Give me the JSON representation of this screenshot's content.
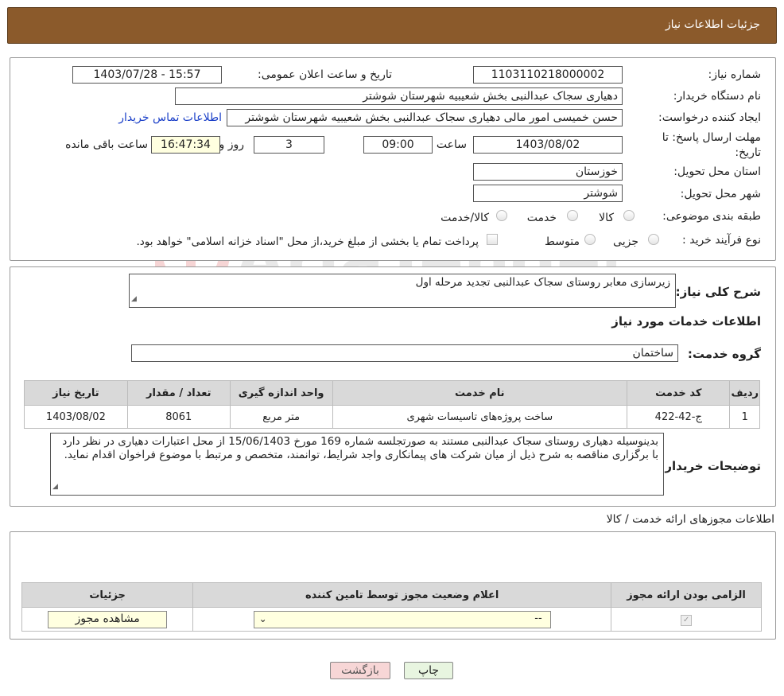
{
  "header": {
    "title": "جزئیات اطلاعات نیاز"
  },
  "form": {
    "need_number_label": "شماره نیاز:",
    "need_number": "1103110218000002",
    "announce_label": "تاریخ و ساعت اعلان عمومی:",
    "announce_value": "1403/07/28 - 15:57",
    "buyer_org_label": "نام دستگاه خریدار:",
    "buyer_org": "دهیاری سجاک عبدالنبی بخش شعیبیه شهرستان شوشتر",
    "requester_label": "ایجاد کننده درخواست:",
    "requester": "حسن خمیسی امور مالی دهیاری سجاک عبدالنبی بخش شعیبیه شهرستان شوشتر",
    "contact_link": "اطلاعات تماس خریدار",
    "deadline_label_1": "مهلت ارسال پاسخ: تا",
    "deadline_label_2": "تاریخ:",
    "deadline_date": "1403/08/02",
    "time_label": "ساعت",
    "deadline_time": "09:00",
    "days_value": "3",
    "days_label": "روز و",
    "remaining_time": "16:47:34",
    "remaining_label": "ساعت باقی مانده",
    "province_label": "استان محل تحویل:",
    "province": "خوزستان",
    "city_label": "شهر محل تحویل:",
    "city": "شوشتر",
    "category_label": "طبقه بندی موضوعی:",
    "category_options": [
      "کالا",
      "خدمت",
      "کالا/خدمت"
    ],
    "process_label": "نوع فرآیند خرید :",
    "process_options": [
      "جزیی",
      "متوسط"
    ],
    "payment_note": "پرداخت تمام یا بخشی از مبلغ خرید،از محل \"اسناد خزانه اسلامی\" خواهد بود."
  },
  "summary": {
    "label": "شرح کلی نیاز:",
    "value": "زیرسازی معابر روستای سجاک عبدالنبی تجدید مرحله اول",
    "services_title": "اطلاعات خدمات مورد نیاز",
    "group_label": "گروه خدمت:",
    "group_value": "ساختمان"
  },
  "services_table": {
    "headers": [
      "ردیف",
      "کد خدمت",
      "نام خدمت",
      "واحد اندازه گیری",
      "تعداد / مقدار",
      "تاریخ نیاز"
    ],
    "rows": [
      [
        "1",
        "ج-42-422",
        "ساخت پروژه‌های تاسیسات شهری",
        "متر مربع",
        "8061",
        "1403/08/02"
      ]
    ]
  },
  "buyer_notes": {
    "label": "توضیحات خریدار:",
    "text": "بدینوسیله دهیاری روستای سجاک عبدالنبی مستند به صورتجلسه شماره 169 مورخ 15/06/1403 از محل اعتبارات دهیاری در نظر دارد با برگزاری مناقصه به شرح ذیل از میان شرکت های پیمانکاری واجد شرایط، توانمند، متخصص و مرتبط با موضوع فراخوان اقدام نماید."
  },
  "permits": {
    "title": "اطلاعات مجوزهای ارائه خدمت / کالا",
    "headers": [
      "الزامی بودن ارائه مجوز",
      "اعلام وضعیت مجوز توسط تامین کننده",
      "جزئیات"
    ],
    "select_value": "--",
    "view_button": "مشاهده مجوز"
  },
  "actions": {
    "print": "چاپ",
    "back": "بازگشت"
  },
  "watermark": {
    "text": "AriaTender.net"
  },
  "colors": {
    "header_bg": "#8b5a2b",
    "print_bg": "#e8f5e0",
    "back_bg": "#f7d6d6",
    "link": "#1a3fc8"
  }
}
